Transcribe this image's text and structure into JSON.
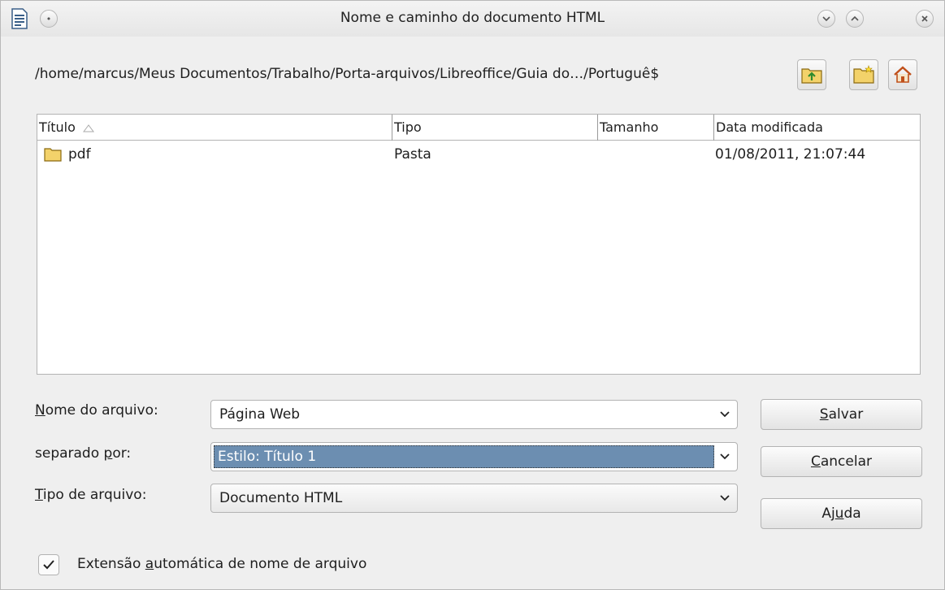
{
  "window": {
    "title": "Nome e caminho do documento HTML"
  },
  "path": {
    "text": "/home/marcus/Meus Documentos/Trabalho/Porta-arquivos/Libreoffice/Guia do…/Portuguê$"
  },
  "toolbar": {
    "up_icon": "folder-up-icon",
    "new_folder_icon": "new-folder-icon",
    "home_icon": "home-icon"
  },
  "file_list": {
    "columns": [
      "Título",
      "Tipo",
      "Tamanho",
      "Data modificada"
    ],
    "rows": [
      {
        "name": "pdf",
        "type": "Pasta",
        "size": "",
        "modified": "01/08/2011, 21:07:44"
      }
    ]
  },
  "form": {
    "filename_label_mnemonic": "N",
    "filename_label_rest": "ome do arquivo:",
    "filename_value": "Página Web",
    "separated_label_pre": "separado ",
    "separated_label_mnemonic": "p",
    "separated_label_post": "or:",
    "separated_value": "Estilo: Título 1",
    "filetype_label_mnemonic": "T",
    "filetype_label_rest": "ipo de arquivo:",
    "filetype_value": "Documento HTML"
  },
  "buttons": {
    "save_mnemonic": "S",
    "save_rest": "alvar",
    "cancel_mnemonic": "C",
    "cancel_rest": "ancelar",
    "help_pre": "Aj",
    "help_mnemonic": "u",
    "help_post": "da"
  },
  "auto_extension": {
    "checked": true,
    "label_pre": "Extensão ",
    "label_mnemonic": "a",
    "label_post": "utomática de nome de arquivo"
  },
  "colors": {
    "selection": "#6c8eb1",
    "folder": "#f3d26a",
    "home": "#e0782a"
  }
}
